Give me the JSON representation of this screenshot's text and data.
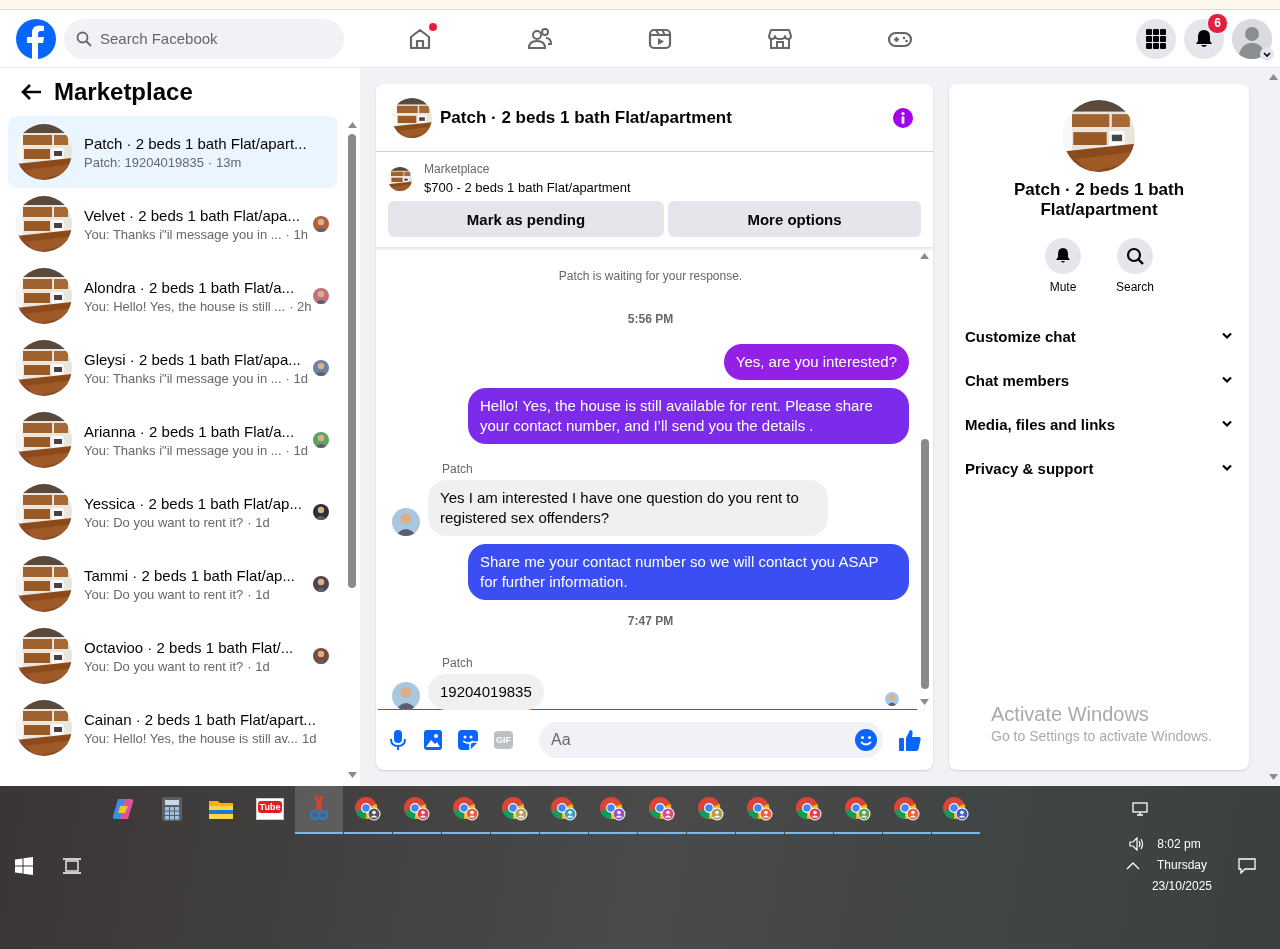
{
  "topbar": {
    "search": {
      "placeholder": "Search Facebook"
    },
    "nav": [
      {
        "kind": "home",
        "unread": true
      },
      {
        "kind": "friends",
        "unread": false
      },
      {
        "kind": "video",
        "unread": false
      },
      {
        "kind": "marketplace",
        "unread": false
      },
      {
        "kind": "gaming",
        "unread": false
      }
    ],
    "notification_count": "6"
  },
  "sidebar": {
    "title": "Marketplace",
    "conversations": [
      {
        "title": "Patch · 2 beds 1 bath Flat/apart...",
        "preview": "Patch: 19204019835",
        "time": "· 13m",
        "selected": true,
        "seen": false
      },
      {
        "title": "Velvet · 2 beds 1 bath Flat/apa...",
        "preview": "You: Thanks i\"il message you in ...",
        "time": "· 1h",
        "selected": false,
        "seen": true
      },
      {
        "title": "Alondra · 2 beds 1 bath Flat/a...",
        "preview": "You: Hello! Yes, the house is still ...",
        "time": "· 2h",
        "selected": false,
        "seen": true
      },
      {
        "title": "Gleysi · 2 beds 1 bath Flat/apa...",
        "preview": "You: Thanks i\"il message you in ...",
        "time": "· 1d",
        "selected": false,
        "seen": true
      },
      {
        "title": "Arianna · 2 beds 1 bath Flat/a...",
        "preview": "You: Thanks i\"il message you in ...",
        "time": "· 1d",
        "selected": false,
        "seen": true
      },
      {
        "title": "Yessica · 2 beds 1 bath Flat/ap...",
        "preview": "You: Do you want to rent it?",
        "time": "· 1d",
        "selected": false,
        "seen": true
      },
      {
        "title": "Tammi · 2 beds 1 bath Flat/ap...",
        "preview": "You: Do you want to rent it?",
        "time": "· 1d",
        "selected": false,
        "seen": true
      },
      {
        "title": "Octavioo · 2 beds 1 bath Flat/...",
        "preview": "You: Do you want to rent it?",
        "time": "· 1d",
        "selected": false,
        "seen": true
      },
      {
        "title": "Cainan · 2 beds 1 bath Flat/apart...",
        "preview": "You: Hello! Yes, the house is still av...",
        "time": "1d",
        "selected": false,
        "seen": false
      }
    ]
  },
  "chat": {
    "title": "Patch · 2 beds 1 bath Flat/apartment",
    "listing": {
      "label": "Marketplace",
      "text": "$700 - 2 beds 1 bath Flat/apartment"
    },
    "buttons": [
      "Mark as pending",
      "More options"
    ],
    "messages": [
      {
        "kind": "notice",
        "text": "Patch is waiting for your response."
      },
      {
        "kind": "time",
        "text": "5:56 PM"
      },
      {
        "kind": "outgoing",
        "text": "Yes, are you interested?",
        "color": "#9420e8"
      },
      {
        "kind": "outgoing",
        "text": "Hello! Yes, the house is still available for rent. Please share your contact number, and I’ll send you the details .",
        "color": "#7b2be9"
      },
      {
        "kind": "incoming",
        "sender": "Patch",
        "text": "Yes I am interested I have one question do you rent to registered sex offenders?"
      },
      {
        "kind": "outgoing",
        "text": "Share me your contact number so we will contact you ASAP for further information.",
        "color": "#3a4ef4"
      },
      {
        "kind": "time",
        "text": "7:47 PM"
      },
      {
        "kind": "incoming",
        "sender": "Patch",
        "text": "19204019835"
      }
    ],
    "composer": {
      "gif_label": "GIF",
      "placeholder": "Aa"
    }
  },
  "info": {
    "title": "Patch · 2 beds 1 bath Flat/apartment",
    "actions": [
      {
        "kind": "mute",
        "label": "Mute"
      },
      {
        "kind": "search",
        "label": "Search"
      }
    ],
    "sections": [
      {
        "label": "Customize chat",
        "expanded": false
      },
      {
        "label": "Chat members",
        "expanded": false
      },
      {
        "label": "Media, files and links",
        "expanded": false
      },
      {
        "label": "Privacy & support",
        "expanded": false
      }
    ]
  },
  "watermark": {
    "title": "Activate Windows",
    "text": "Go to Settings to activate Windows."
  },
  "taskbar": {
    "apps": [
      {
        "kind": "copilot",
        "open": false,
        "active": false
      },
      {
        "kind": "calculator",
        "open": false,
        "active": false
      },
      {
        "kind": "explorer",
        "open": false,
        "active": false
      },
      {
        "kind": "youtube",
        "label": "Tube",
        "open": false,
        "active": false
      },
      {
        "kind": "snipping",
        "open": true,
        "active": true
      },
      {
        "kind": "chrome",
        "color": "#555555",
        "open": true,
        "active": false
      },
      {
        "kind": "chrome",
        "color": "#e0405a",
        "open": true,
        "active": false
      },
      {
        "kind": "chrome",
        "color": "#e8603c",
        "open": true,
        "active": false
      },
      {
        "kind": "chrome",
        "color": "#b8a060",
        "open": true,
        "active": false
      },
      {
        "kind": "chrome",
        "color": "#40a0c0",
        "open": true,
        "active": false
      },
      {
        "kind": "chrome",
        "color": "#9b4fd0",
        "open": true,
        "active": false
      },
      {
        "kind": "chrome",
        "color": "#e04890",
        "open": true,
        "active": false
      },
      {
        "kind": "chrome",
        "color": "#b0a050",
        "open": true,
        "active": false
      },
      {
        "kind": "chrome",
        "color": "#e8603c",
        "open": true,
        "active": false
      },
      {
        "kind": "chrome",
        "color": "#e04050",
        "open": true,
        "active": false
      },
      {
        "kind": "chrome",
        "color": "#60a050",
        "open": true,
        "active": false
      },
      {
        "kind": "chrome",
        "color": "#e8603c",
        "open": true,
        "active": false
      },
      {
        "kind": "chrome",
        "color": "#4060c0",
        "open": true,
        "active": false
      }
    ],
    "time": "8:02 pm",
    "day": "Thursday",
    "date": "23/10/2025"
  }
}
